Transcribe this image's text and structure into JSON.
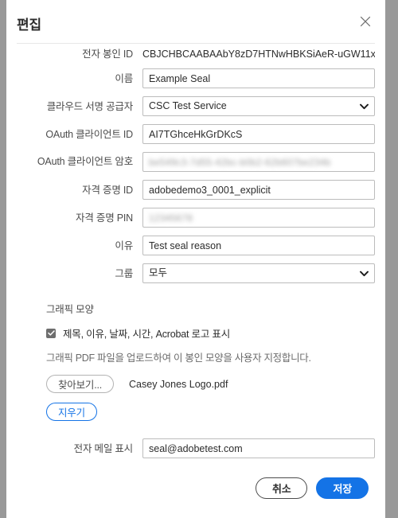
{
  "dialog": {
    "title": "편집",
    "close_icon": "close-icon"
  },
  "fields": {
    "seal_id": {
      "label": "전자 봉인 ID",
      "value": "CBJCHBCAABAAbY8zD7HTNwHBKSiAeR-uGW11x"
    },
    "name": {
      "label": "이름",
      "value": "Example Seal"
    },
    "provider": {
      "label": "클라우드 서명 공급자",
      "value": "CSC Test Service",
      "options": [
        "CSC Test Service"
      ]
    },
    "oauth_client_id": {
      "label": "OAuth 클라이언트 ID",
      "value": "AI7TGhceHkGrDKcS"
    },
    "oauth_client_secret": {
      "label": "OAuth 클라이언트 암호",
      "value": "be549c3-7d55-42bc-b0b2-62b607be234b"
    },
    "credential_id": {
      "label": "자격 증명 ID",
      "value": "adobedemo3_0001_explicit"
    },
    "credential_pin": {
      "label": "자격 증명 PIN",
      "value": "12345678"
    },
    "reason": {
      "label": "이유",
      "value": "Test seal reason"
    },
    "group": {
      "label": "그룹",
      "value": "모두",
      "options": [
        "모두"
      ]
    },
    "email": {
      "label": "전자 메일 표시",
      "value": "seal@adobetest.com"
    }
  },
  "graphic_section": {
    "title": "그래픽 모양",
    "checkbox_label": "제목, 이유, 날짜, 시간, Acrobat 로고 표시",
    "checkbox_checked": true,
    "description": "그래픽 PDF 파일을 업로드하여 이 봉인 모양을 사용자 지정합니다.",
    "browse_label": "찾아보기...",
    "file_name": "Casey Jones Logo.pdf",
    "clear_label": "지우기"
  },
  "footer": {
    "cancel_label": "취소",
    "save_label": "저장"
  },
  "colors": {
    "accent_blue": "#1473e6",
    "backdrop": "#999999",
    "border": "#bcbcbc",
    "label_text": "#4b4b4b"
  }
}
